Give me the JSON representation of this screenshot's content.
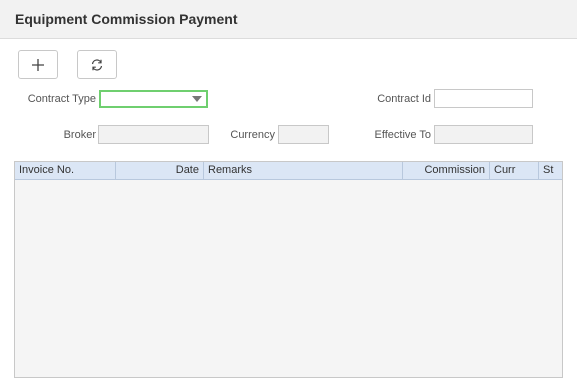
{
  "header": {
    "title": "Equipment Commission Payment"
  },
  "toolbar": {
    "add_icon": "plus-icon",
    "refresh_icon": "refresh-icon"
  },
  "form": {
    "contract_type_label": "Contract Type",
    "contract_type_value": "",
    "contract_id_label": "Contract Id",
    "contract_id_value": "",
    "broker_label": "Broker",
    "broker_value": "",
    "currency_label": "Currency",
    "currency_value": "",
    "effective_to_label": "Effective To",
    "effective_to_value": ""
  },
  "grid": {
    "columns": [
      "Invoice No.",
      "Date",
      "Remarks",
      "Commission",
      "Curr",
      "St"
    ],
    "rows": []
  },
  "colors": {
    "focus_border": "#6fcf6f",
    "grid_header": "#dbe6f5"
  }
}
